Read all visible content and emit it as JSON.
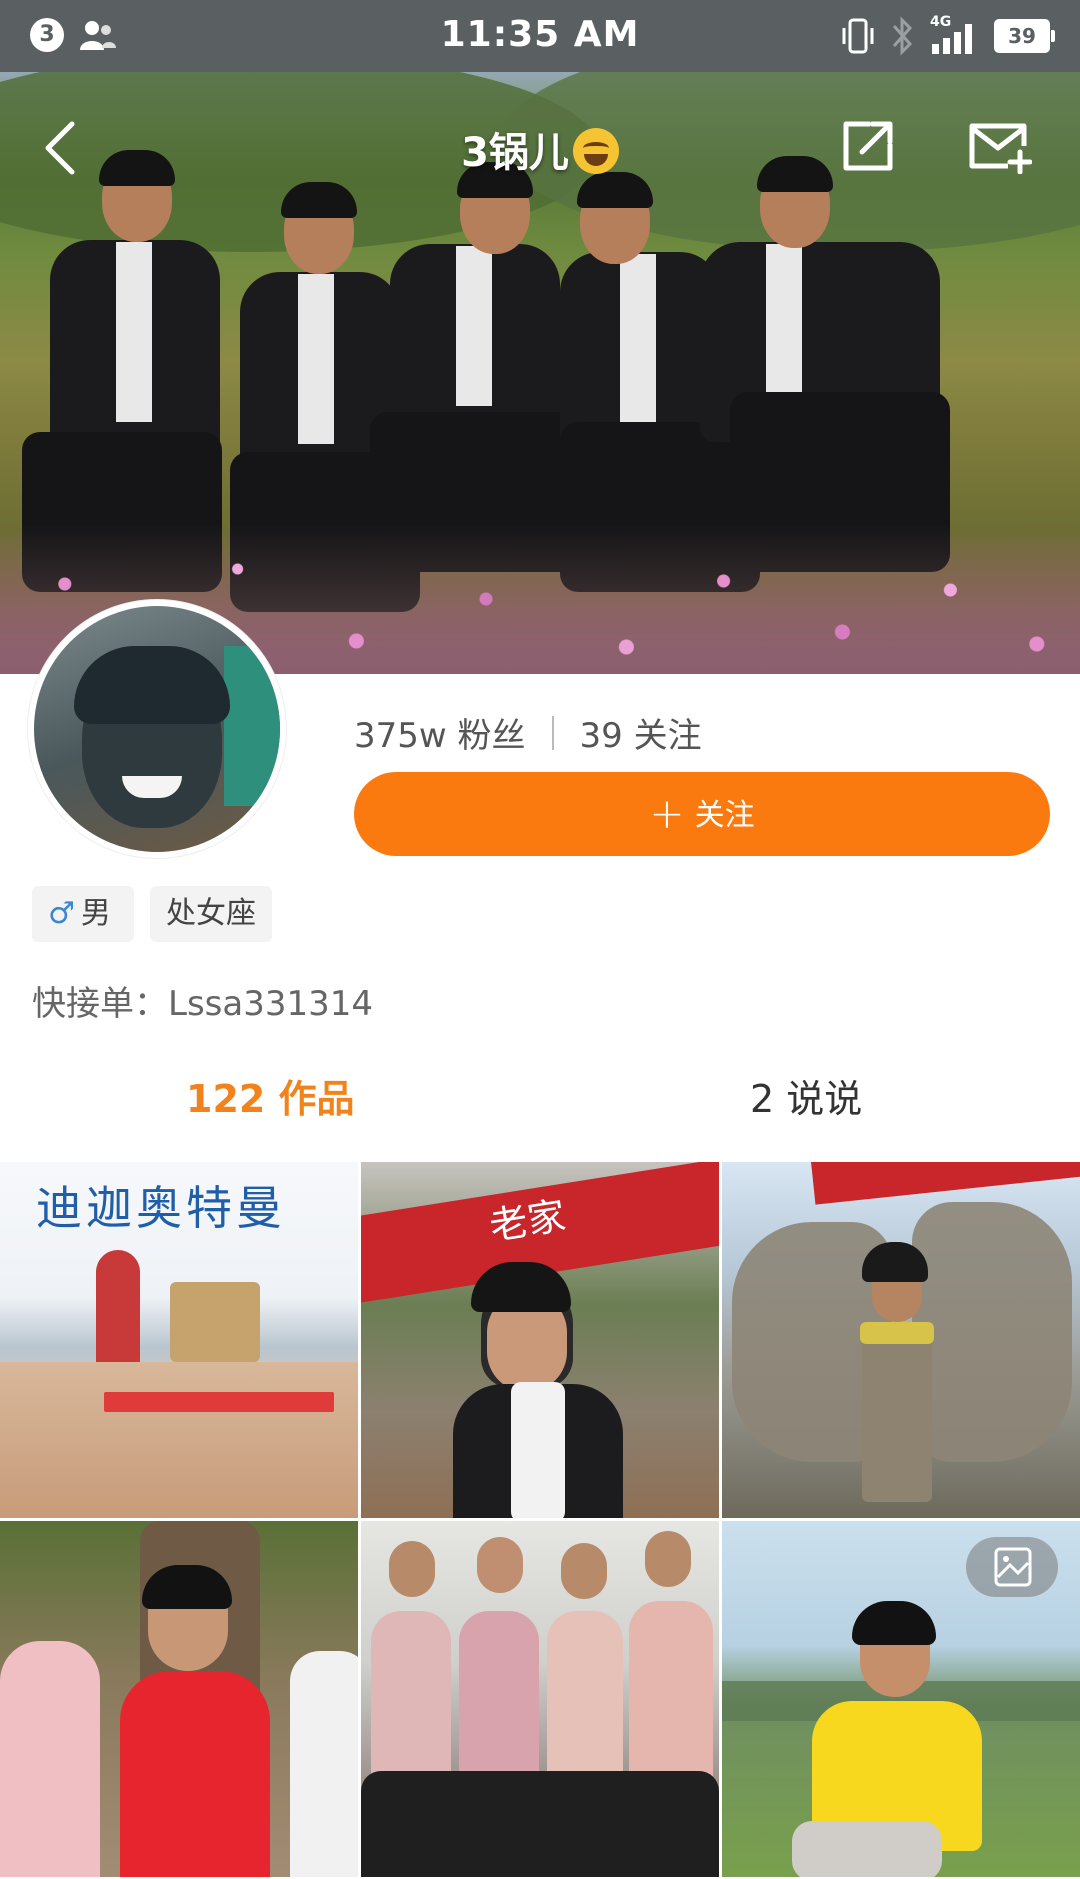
{
  "status_bar": {
    "notification_count": "3",
    "time": "11:35 AM",
    "network": "4G",
    "battery": "39"
  },
  "header": {
    "title": "3锅儿",
    "title_emoji": "face-with-tears-of-joy"
  },
  "profile": {
    "fans": "375w 粉丝",
    "following": "39 关注",
    "follow_button": "关注",
    "gender_symbol": "♂",
    "gender": "男",
    "zodiac": "处女座",
    "contact": "快接单：Lssa331314"
  },
  "tabs": {
    "works": "122 作品",
    "posts": "2 说说"
  },
  "grid": [
    {
      "caption": "迪迦奥特曼"
    },
    {
      "caption": "老家"
    },
    {
      "caption": ""
    },
    {
      "caption": ""
    },
    {
      "caption": ""
    },
    {
      "caption": "",
      "badge": "image-icon"
    }
  ],
  "colors": {
    "accent": "#fb7a10",
    "tab_active": "#f0831c",
    "status_bar": "#5a6062",
    "male_icon": "#3a86d4"
  }
}
